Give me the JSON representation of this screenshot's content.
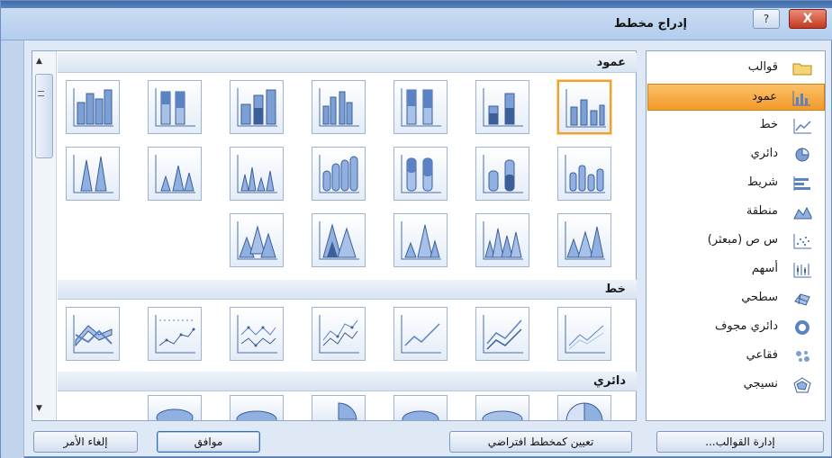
{
  "window": {
    "title": "إدراج مخطط",
    "close_glyph": "X",
    "help_glyph": "?"
  },
  "sidebar": {
    "items": [
      {
        "label": "قوالب",
        "icon": "folder-icon"
      },
      {
        "label": "عمود",
        "icon": "column-chart-icon",
        "selected": true
      },
      {
        "label": "خط",
        "icon": "line-chart-icon"
      },
      {
        "label": "دائري",
        "icon": "pie-chart-icon"
      },
      {
        "label": "شريط",
        "icon": "bar-chart-icon"
      },
      {
        "label": "منطقة",
        "icon": "area-chart-icon"
      },
      {
        "label": "س ص (مبعثر)",
        "icon": "scatter-chart-icon"
      },
      {
        "label": "أسهم",
        "icon": "stock-chart-icon"
      },
      {
        "label": "سطحي",
        "icon": "surface-chart-icon"
      },
      {
        "label": "دائري مجوف",
        "icon": "doughnut-chart-icon"
      },
      {
        "label": "فقاعي",
        "icon": "bubble-chart-icon"
      },
      {
        "label": "نسيجي",
        "icon": "radar-chart-icon"
      }
    ]
  },
  "gallery": {
    "sections": [
      {
        "label": "عمود"
      },
      {
        "label": "خط"
      },
      {
        "label": "دائري"
      }
    ]
  },
  "buttons": {
    "manage_templates": "إدارة القوالب...",
    "set_default": "تعيين كمخطط افتراضي",
    "ok": "موافق",
    "cancel": "إلغاء الأمر"
  },
  "colors": {
    "accent": "#f29a2b",
    "chart_blue": "#5b82c2",
    "frame": "#8ea6c8"
  }
}
